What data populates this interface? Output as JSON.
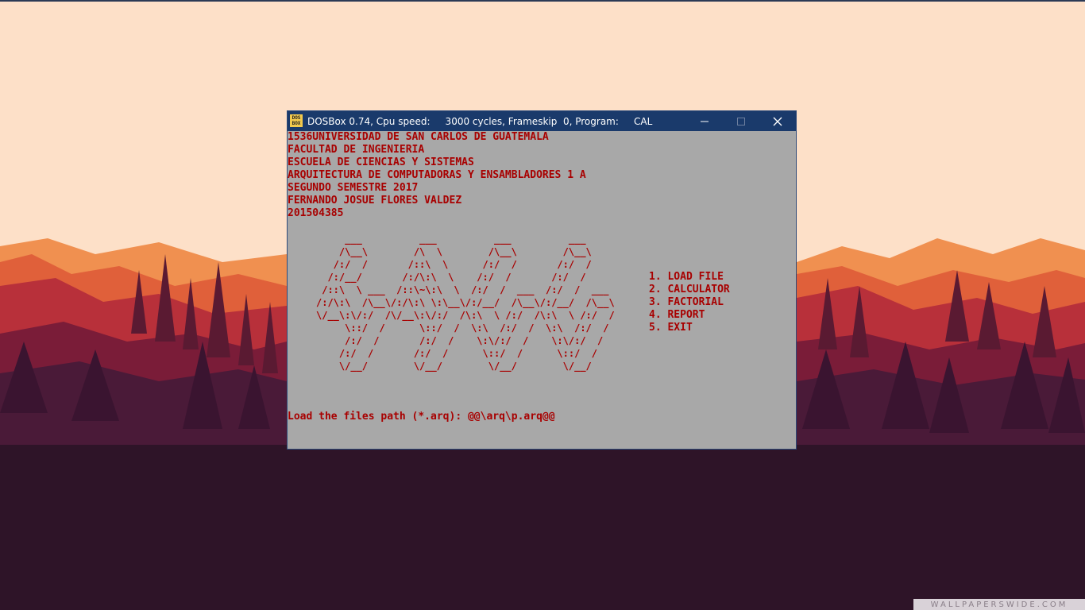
{
  "window": {
    "title": "DOSBox 0.74, Cpu speed:     3000 cycles, Frameskip  0, Program:     CAL",
    "icon": "dosbox-icon",
    "icon_text": "DOS BOX",
    "controls": [
      "minimize-icon",
      "maximize-icon",
      "close-icon"
    ]
  },
  "console": {
    "header_lines": [
      "1536UNIVERSIDAD DE SAN CARLOS DE GUATEMALA",
      "FACULTAD DE INGENIERIA",
      "ESCUELA DE CIENCIAS Y SISTEMAS",
      "ARQUITECTURA DE COMPUTADORAS Y ENSAMBLADORES 1 A",
      "SEGUNDO SEMESTRE 2017",
      "FERNANDO JOSUE FLORES VALDEZ",
      "201504385"
    ],
    "logo_art": "     ___          ___          ___          ___\n    /\\__\\        /\\  \\        /\\__\\        /\\__\\\n   /:/  /       /::\\  \\      /:/  /       /:/  /\n  /:/__/       /:/\\:\\  \\    /:/  /       /:/  /\n /::\\  \\ ___  /::\\~\\:\\  \\  /:/  /  ___  /:/  /  ___\n/:/\\:\\  /\\__\\/:/\\:\\ \\:\\__\\/:/__/  /\\__\\/:/__/  /\\__\\\n\\/__\\:\\/:/  /\\/__\\:\\/:/  /\\:\\  \\ /:/  /\\:\\  \\ /:/  /\n     \\::/  /      \\::/  /  \\:\\  /:/  /  \\:\\  /:/  /\n     /:/  /       /:/  /    \\:\\/:/  /    \\:\\/:/  /\n    /:/  /       /:/  /      \\::/  /      \\::/  /\n    \\/__/        \\/__/        \\/__/        \\/__/",
    "menu": [
      "1. LOAD FILE",
      "2. CALCULATOR",
      "3. FACTORIAL",
      "4. REPORT",
      "5. EXIT"
    ],
    "prompt": "Load the files path (*.arq): @@\\arq\\p.arq@@"
  },
  "desktop": {
    "watermark": "WALLPAPERSWIDE.COM"
  },
  "colors": {
    "console_bg": "#a8a8a8",
    "console_text": "#a80000",
    "titlebar": "#1a3a6b"
  }
}
